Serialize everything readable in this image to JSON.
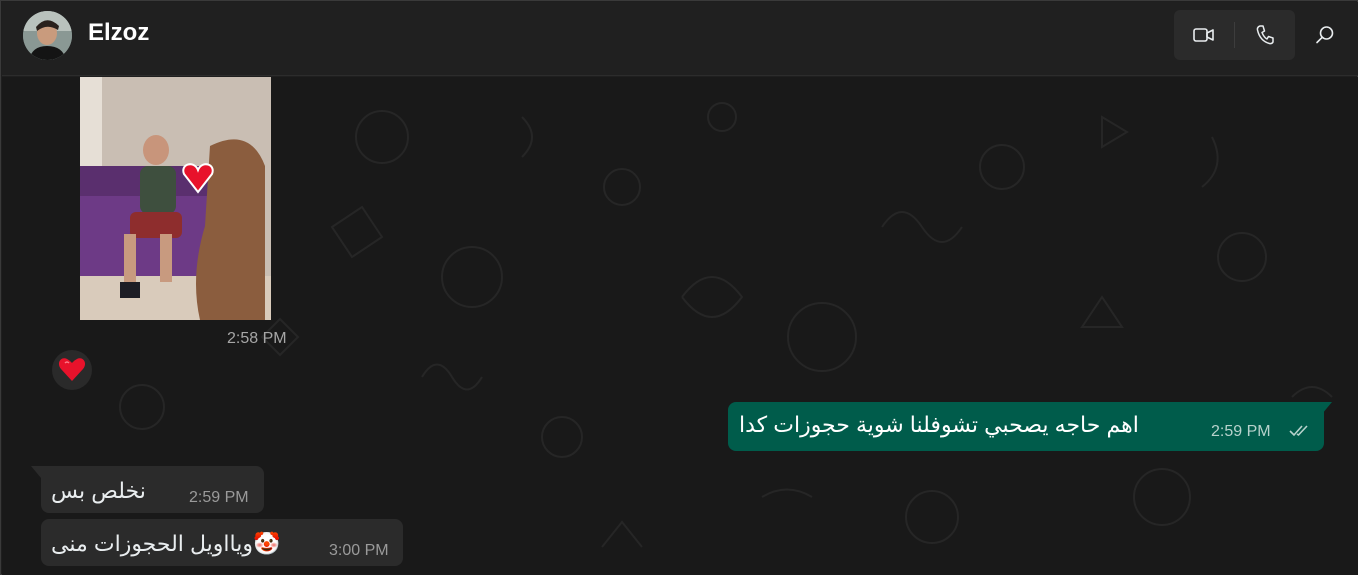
{
  "header": {
    "contact_name": "Elzoz",
    "avatar_icon": "contact-avatar",
    "video_call_icon": "video-camera-icon",
    "voice_call_icon": "phone-icon",
    "search_icon": "search-icon"
  },
  "messages": {
    "media": {
      "time": "2:58 PM",
      "sticker": "red-heart",
      "reaction": "❤️"
    },
    "outgoing": {
      "text": "اهم حاجه يصحبي تشوفلنا شوية حجوزات كدا",
      "time": "2:59 PM",
      "status_icon": "double-check-icon"
    },
    "incoming": [
      {
        "text": "نخلص بس",
        "time": "2:59 PM"
      },
      {
        "text": "ويااويل الحجوزات منى🤡",
        "time": "3:00 PM"
      }
    ]
  },
  "colors": {
    "header_bg": "#202020",
    "chat_bg": "#191919",
    "outgoing_bubble": "#005c4b",
    "incoming_bubble": "#2b2b2b",
    "heart": "#e8122b"
  }
}
